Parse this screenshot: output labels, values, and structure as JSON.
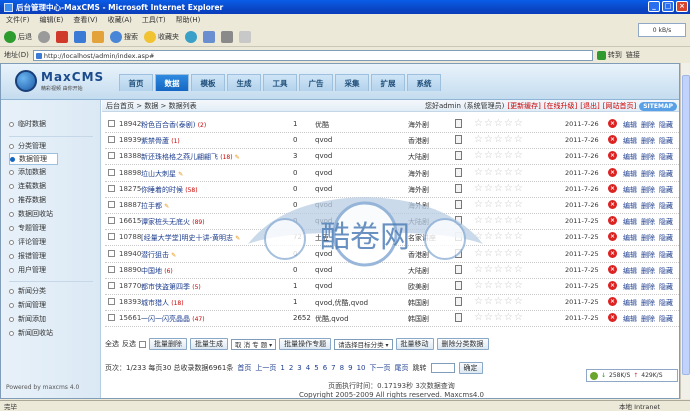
{
  "window": {
    "title": "后台管理中心-MaxCMS - Microsoft Internet Explorer"
  },
  "menu": [
    "文件(F)",
    "编辑(E)",
    "查看(V)",
    "收藏(A)",
    "工具(T)",
    "帮助(H)"
  ],
  "toolbar": {
    "back": "后退",
    "search": "搜索",
    "favorites": "收藏夹"
  },
  "address": {
    "label": "地址(D)",
    "url": "http://localhost/admin/index.asp#",
    "go": "转到",
    "links": "链接"
  },
  "kbps": "0 kB/s",
  "logo": {
    "name": "MaxCMS",
    "tagline": "精彩视频 由你开始"
  },
  "nav": [
    "首页",
    "数据",
    "模板",
    "生成",
    "工具",
    "广告",
    "采集",
    "扩展",
    "系统"
  ],
  "sidebar": {
    "items": [
      "临时数据",
      "分类管理",
      "数据管理",
      "添加数据",
      "连载数据",
      "推荐数据",
      "数据回收站",
      "专题管理",
      "评论管理",
      "报错管理",
      "用户管理",
      "新闻分类",
      "新闻管理",
      "新闻添加",
      "新闻回收站"
    ],
    "powered": "Powered by maxcms 4.0"
  },
  "crumb": {
    "path": "后台首页 > 数据 > 数据列表",
    "welcome": "您好admin",
    "role": "(系统管理员)",
    "update": "[更新缓存]",
    "links": [
      "[在线升级]",
      "[退出]",
      "[网站首页]"
    ],
    "sitemap": "SITEMAP"
  },
  "rows": [
    {
      "id": "18942",
      "name": "粉色百合香(泰剧)",
      "count": "(2)",
      "hot": false,
      "num": "1",
      "src": "优酷",
      "region": "海外剧",
      "date": "2011-7-26"
    },
    {
      "id": "18939",
      "name": "紫禁骨蘆",
      "count": "(1)",
      "hot": false,
      "num": "0",
      "src": "qvod",
      "region": "香港剧",
      "date": "2011-7-26"
    },
    {
      "id": "18388",
      "name": "新还珠格格之燕儿翩翩飞",
      "count": "(18)",
      "hot": true,
      "num": "3",
      "src": "qvod",
      "region": "大陆剧",
      "date": "2011-7-26"
    },
    {
      "id": "18898",
      "name": "垃山大刺星",
      "count": "",
      "hot": true,
      "num": "0",
      "src": "qvod",
      "region": "海外剧",
      "date": "2011-7-26"
    },
    {
      "id": "18275",
      "name": "你睡着的时候",
      "count": "(58)",
      "hot": false,
      "num": "0",
      "src": "qvod",
      "region": "海外剧",
      "date": "2011-7-26"
    },
    {
      "id": "18887",
      "name": "拉手都",
      "count": "",
      "hot": true,
      "num": "0",
      "src": "qvod",
      "region": "海外剧",
      "date": "2011-7-26"
    },
    {
      "id": "16615",
      "name": "谭家桩头无底火",
      "count": "(89)",
      "hot": false,
      "num": "0",
      "src": "qvod",
      "region": "大陆剧",
      "date": "2011-7-25"
    },
    {
      "id": "10788",
      "name": "[经量大学堂]明史十讲-黄明志",
      "count": "",
      "hot": true,
      "num": "72",
      "src": "土豆",
      "region": "名家讲座",
      "date": "2011-7-25"
    },
    {
      "id": "18940",
      "name": "潜行狙击",
      "count": "",
      "hot": true,
      "num": "0",
      "src": "qvod",
      "region": "香港剧",
      "date": "2011-7-25"
    },
    {
      "id": "18890",
      "name": "中国地",
      "count": "(6)",
      "hot": false,
      "num": "0",
      "src": "qvod",
      "region": "大陆剧",
      "date": "2011-7-25"
    },
    {
      "id": "18770",
      "name": "都市侠盗第四季",
      "count": "(5)",
      "hot": false,
      "num": "1",
      "src": "qvod",
      "region": "欧美剧",
      "date": "2011-7-25"
    },
    {
      "id": "18393",
      "name": "城市猎人",
      "count": "(18)",
      "hot": false,
      "num": "1",
      "src": "qvod,优酷,qvod",
      "region": "韩国剧",
      "date": "2011-7-25"
    },
    {
      "id": "15661",
      "name": "一闪一闪亮晶晶",
      "count": "(47)",
      "hot": false,
      "num": "2652",
      "src": "优酷,qvod",
      "region": "韩国剧",
      "date": "2011-7-25"
    }
  ],
  "row_actions": [
    "编辑",
    "删除",
    "隐藏"
  ],
  "batch": {
    "select_all": "全选",
    "invert": "反选",
    "buttons": [
      "批量删除",
      "批量生成",
      "批量操作专题",
      "批量移动",
      "删除分类数据"
    ],
    "topic_select": "取 消 专 题",
    "category_select": "请选择目标分类"
  },
  "pager": {
    "info": "页次：1/233 每页30 总收录数据6961条",
    "first": "首页",
    "prev": "上一页",
    "pages": [
      "1",
      "2",
      "3",
      "4",
      "5",
      "6",
      "7",
      "8",
      "9",
      "10"
    ],
    "next": "下一页",
    "last": "尾页",
    "jump": "跳转",
    "ok": "确定"
  },
  "footer": {
    "line1": "页面执行时间：0.17193秒 3次数据查询",
    "line2": "Copyright 2005-2009 All rights reserved. Maxcms4.0"
  },
  "watermark": "酷卷网",
  "speed": {
    "down": "258K/S",
    "up": "429K/S"
  },
  "status": {
    "left": "完毕",
    "zone": "本地 Intranet"
  }
}
